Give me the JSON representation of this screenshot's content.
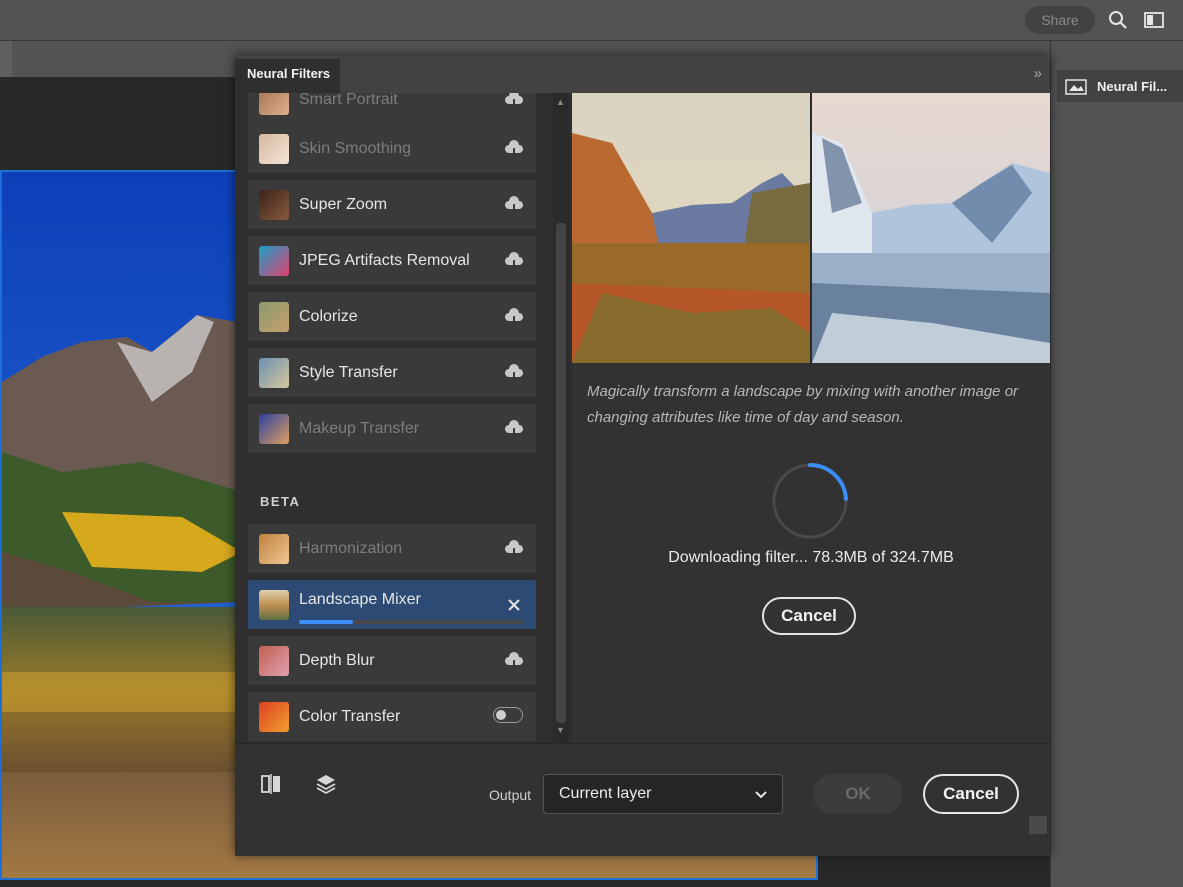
{
  "topbar": {
    "share_label": "Share"
  },
  "right_panel": {
    "tab_label": "Neural Fil..."
  },
  "dialog": {
    "title": "Neural Filters",
    "beta_label": "BETA",
    "filters": [
      {
        "name": "Smart Portrait",
        "dim": true,
        "action": "cloud-download-icon"
      },
      {
        "name": "Skin Smoothing",
        "dim": true,
        "action": "cloud-download-icon"
      },
      {
        "name": "Super Zoom",
        "dim": false,
        "action": "cloud-download-icon"
      },
      {
        "name": "JPEG Artifacts Removal",
        "dim": false,
        "action": "cloud-download-icon"
      },
      {
        "name": "Colorize",
        "dim": false,
        "action": "cloud-download-icon"
      },
      {
        "name": "Style Transfer",
        "dim": false,
        "action": "cloud-download-icon"
      },
      {
        "name": "Makeup Transfer",
        "dim": true,
        "action": "cloud-download-icon"
      }
    ],
    "beta_filters": [
      {
        "name": "Harmonization",
        "dim": true,
        "action": "cloud-download-icon"
      },
      {
        "name": "Landscape Mixer",
        "dim": false,
        "action": "close-icon",
        "selected": true,
        "progress": 0.24
      },
      {
        "name": "Depth Blur",
        "dim": false,
        "action": "cloud-download-icon"
      },
      {
        "name": "Color Transfer",
        "dim": false,
        "action": "toggle-off"
      }
    ],
    "detail": {
      "description": "Magically transform a landscape by mixing with another image or changing attributes like time of day and season.",
      "download_status": "Downloading filter... 78.3MB of 324.7MB",
      "download_progress": 0.24,
      "cancel_download_label": "Cancel"
    },
    "footer": {
      "output_label": "Output",
      "output_value": "Current layer",
      "ok_label": "OK",
      "cancel_label": "Cancel"
    }
  },
  "colors": {
    "accent": "#3d8ef8",
    "selected_row": "#2c4a73",
    "canvas_border": "#1b6fd6"
  }
}
